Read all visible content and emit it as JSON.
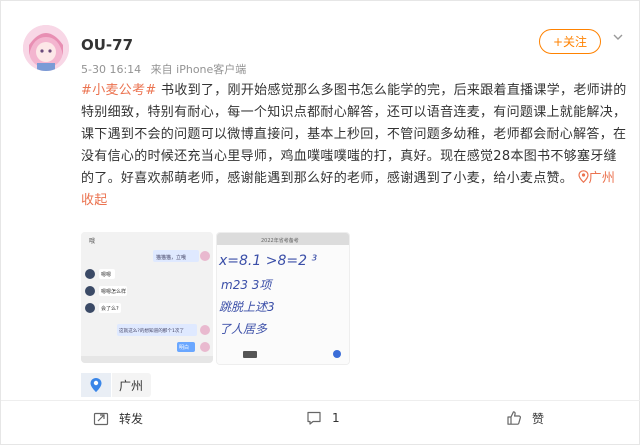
{
  "user": {
    "name": "OU-77",
    "date": "5-30 16:14",
    "source": "来自 iPhone客户端"
  },
  "follow": {
    "label": "+关注"
  },
  "post": {
    "tag": "#小麦公考#",
    "body": " 书收到了，刚开始感觉那么多图书怎么能学的完，后来跟着直播课学，老师讲的特别细致，特别有耐心，每一个知识点都耐心解答，还可以语音连麦，有问题课上就能解决，课下遇到不会的问题可以微博直接问，基本上秒回，不管问题多幼稚，老师都会耐心解答，在没有信心的时候还充当心里导师，鸡血噗嗤噗嗤的打，真好。现在感觉28本图书不够塞牙缝的了。好喜欢郝萌老师，感谢能遇到那么好的老师，感谢遇到了小麦，给小麦点赞。",
    "location_link": "广州",
    "collapse": "收起"
  },
  "images": {
    "chat": {
      "top_text": "哦",
      "bubble1": "猫猫猫，立哦",
      "msg1": "嗯嗯",
      "msg2": "嗯嗯怎么样",
      "msg3": "会了么?",
      "bubble2": "这就这么?的想知道的那个1次了",
      "bubble3": "明白"
    },
    "notes": {
      "header": "2022年省考备考",
      "line1": "x=8.1  >8=2 ³",
      "line2": "m23 3项",
      "line3": "跳脱上述3",
      "line4": "了人居多"
    }
  },
  "geo": {
    "city": "广州"
  },
  "actions": {
    "repost": "转发",
    "comment_count": "1",
    "like": "赞"
  },
  "colors": {
    "accent": "#ff8200",
    "link": "#eb7350"
  }
}
